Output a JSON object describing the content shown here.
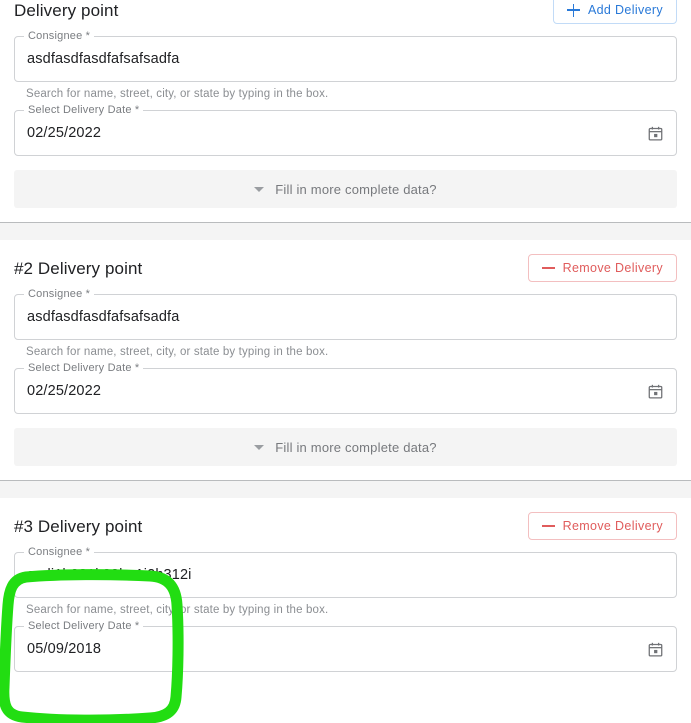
{
  "app": {
    "header_title": "Delivery point",
    "add_button_label": "Add Delivery",
    "add_button_icon": "plus-icon",
    "remove_button_icon": "minus-icon",
    "calendar_icon": "calendar-icon",
    "caret_icon": "chevron-down-icon",
    "colors": {
      "accent_blue": "#2979d8",
      "accent_blue_border": "#c2dbf7",
      "danger_red": "#e05c5c",
      "danger_red_border": "#f3bfc0",
      "field_border": "#d0d2d5",
      "label_gray": "#7a7d81",
      "helper_gray": "#8b8e92",
      "strip_bg": "#f4f4f4",
      "text_primary": "#202124",
      "annotation_green": "#22dd12"
    }
  },
  "labels": {
    "consignee": "Consignee *",
    "delivery_date": "Select Delivery Date *",
    "consignee_helper": "Search for name, street, city, or state by typing in the box.",
    "expander": "Fill in more complete data?",
    "remove_button_label": "Remove Delivery"
  },
  "sections": [
    {
      "title": "Delivery point",
      "consignee_value": "asdfasdfasdfafsafsadfa",
      "consignee_placeholder": "",
      "date_value": "02/25/2022",
      "has_remove": false,
      "has_expander": true,
      "highlighted": false
    },
    {
      "title": "#2 Delivery point",
      "consignee_value": "asdfasdfasdfafsafsadfa",
      "consignee_placeholder": "",
      "date_value": "02/25/2022",
      "has_remove": true,
      "has_expander": true,
      "highlighted": false
    },
    {
      "title": "#3 Delivery point",
      "consignee_value": "asdi1h231k23ho1i2h312i",
      "consignee_placeholder": "",
      "date_value": "05/09/2018",
      "has_remove": true,
      "has_expander": false,
      "highlighted": true
    }
  ],
  "annotation": {
    "shape": "hand-drawn-rounded-rectangle",
    "color": "#22dd12"
  }
}
